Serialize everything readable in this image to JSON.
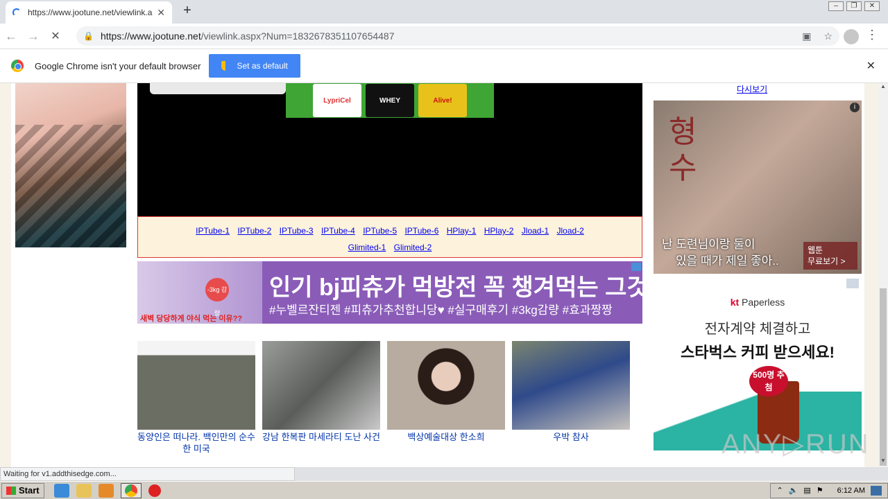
{
  "browser": {
    "tab_title": "https://www.jootune.net/viewlink.a",
    "tab_close": "✕",
    "new_tab": "+",
    "url_host": "https://www.jootune.net",
    "url_path": "/viewlink.aspx?Num=1832678351107654487",
    "lock_icon": "lock-icon",
    "menu": "⋮"
  },
  "infobar": {
    "message": "Google Chrome isn't your default browser",
    "button_label": "Set as default",
    "close": "✕"
  },
  "page": {
    "right_top_link": "다시보기",
    "links_row1": [
      "IPTube-1",
      "IPTube-2",
      "IPTube-3",
      "IPTube-4",
      "IPTube-5",
      "IPTube-6",
      "HPlay-1",
      "HPlay-2",
      "Jload-1",
      "Jload-2"
    ],
    "links_row2": [
      "Glimited-1",
      "Glimited-2"
    ],
    "video_banner_products": [
      "LypriCel",
      "WHEY",
      "Alive!"
    ],
    "ad_banner": {
      "title": "인기 bj피츄가 먹방전 꼭 챙겨먹는 그것",
      "tags": "#누벨르잔티젠 #피츄가추천합니당♥ #실구매후기 #3kg감량 #효과짱짱",
      "sub": "새벽 당당하게 야식 먹는 이유??",
      "chip": "-3kg 감량"
    },
    "thumbs": [
      {
        "caption": "동양인은 떠나라. 백인만의 순수한 미국",
        "color": "#6b6f63"
      },
      {
        "caption": "강남 한복판 마세라티 도난 사건",
        "color": "#8c8f8c"
      },
      {
        "caption": "백상예술대상 한소희",
        "color": "#a79a8d"
      },
      {
        "caption": "우박 참사",
        "color": "#4a5a7a"
      }
    ],
    "right_ad1": {
      "big": "형수",
      "message_line1": "난 도련님이랑 둘이",
      "message_line2": "있을 때가 제일 좋아..",
      "cta_line1": "웹툰",
      "cta_line2": "무료보기 >",
      "info": "i"
    },
    "right_ad2": {
      "brand_kt": "kt",
      "brand_name": " Paperless",
      "line1": "전자계약 체결하고",
      "line2": "스타벅스 커피 받으세요!",
      "badge": "500명 추첨"
    },
    "watermark": "ANY▷RUN"
  },
  "status_text": "Waiting for v1.addthisedge.com...",
  "taskbar": {
    "start": "Start",
    "clock": "6:12 AM"
  }
}
